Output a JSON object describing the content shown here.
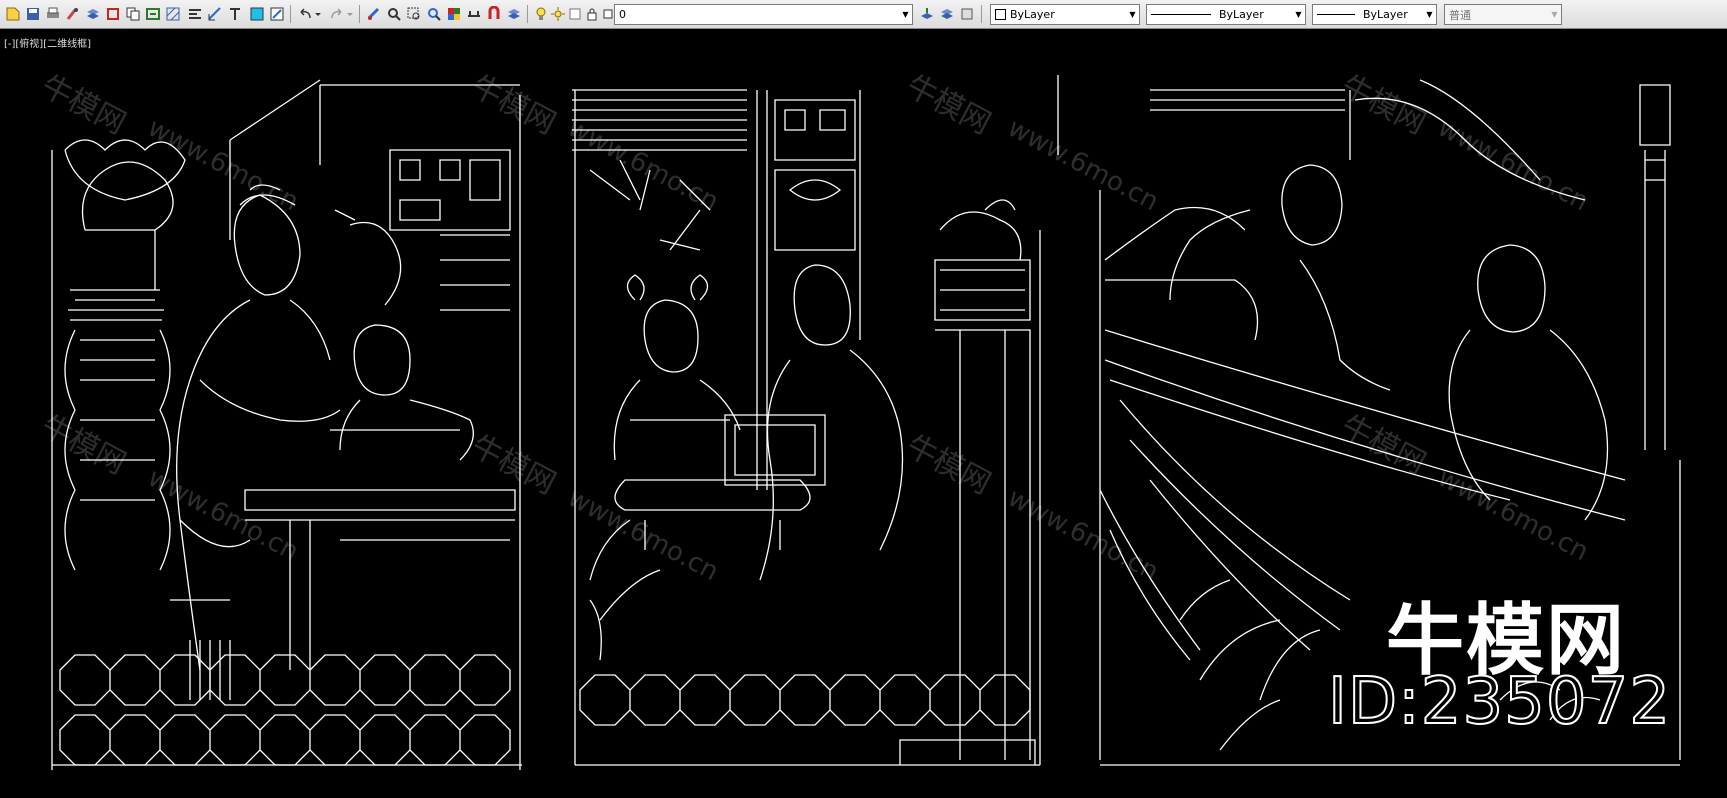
{
  "toolbar": {
    "icons": [
      "new-file-icon",
      "save-icon",
      "match-properties-icon",
      "layers-icon",
      "print-icon",
      "copy-icon",
      "block-icon",
      "hatch-icon",
      "text-icon",
      "insert-icon",
      "color-icon",
      "undo-icon",
      "redo-icon",
      "pan-icon",
      "zoom-realtime-icon",
      "zoom-window-icon",
      "zoom-previous-icon",
      "properties-icon",
      "design-center-icon",
      "tool-palettes-icon",
      "layer-state-icon"
    ],
    "layer_combo": "0",
    "color_combo": "ByLayer",
    "linetype_combo": "ByLayer",
    "lineweight_combo": "ByLayer",
    "plotstyle_combo": "普通"
  },
  "viewport": {
    "label": "[-][俯视][二维线框]"
  },
  "watermark": {
    "site_cn": "牛模网",
    "site_url": "www.6mo.cn",
    "brand": "牛模网",
    "id_text": "ID:235072"
  },
  "colors": {
    "background": "#000000",
    "lines": "#ffffff",
    "toolbar_bg": "#e6e6e6"
  }
}
